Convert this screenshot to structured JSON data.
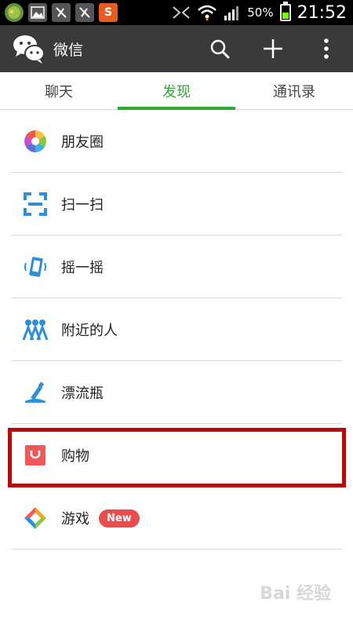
{
  "status_bar": {
    "battery_percent": "50%",
    "time": "21:52",
    "notification_s": "S"
  },
  "app_bar": {
    "title": "微信",
    "actions": {
      "search": "search-icon",
      "add": "plus-icon",
      "more": "more-icon"
    }
  },
  "tabs": [
    {
      "label": "聊天",
      "active": false
    },
    {
      "label": "发现",
      "active": true
    },
    {
      "label": "通讯录",
      "active": false
    }
  ],
  "discover": {
    "items": [
      {
        "label": "朋友圈",
        "icon": "moments-icon"
      },
      {
        "label": "扫一扫",
        "icon": "scan-icon"
      },
      {
        "label": "摇一摇",
        "icon": "shake-icon"
      },
      {
        "label": "附近的人",
        "icon": "people-nearby-icon"
      },
      {
        "label": "漂流瓶",
        "icon": "drift-bottle-icon"
      },
      {
        "label": "购物",
        "icon": "shopping-icon"
      },
      {
        "label": "游戏",
        "icon": "games-icon",
        "badge": "New"
      }
    ]
  },
  "watermark": "Bai 经验",
  "colors": {
    "accent": "#2aaa30",
    "appbar": "#3a3a3c",
    "badge": "#ea4d4d",
    "highlight": "#b00e0e"
  }
}
